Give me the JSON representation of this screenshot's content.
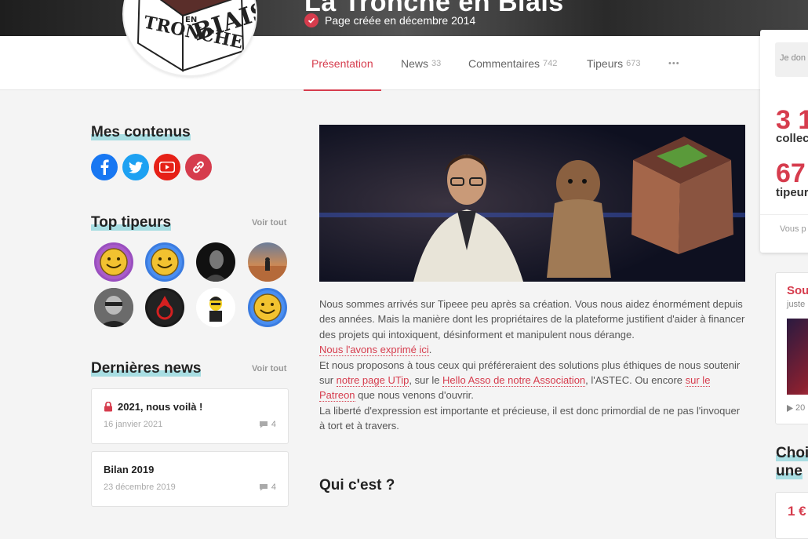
{
  "header": {
    "title": "La Tronche en Biais",
    "created_text": "Page créée en décembre 2014"
  },
  "logo": {
    "text_top": "TRONCHE",
    "text_side": "BIAIS",
    "text_bottom": "EN"
  },
  "nav": {
    "tabs": [
      {
        "label": "Présentation",
        "count": ""
      },
      {
        "label": "News",
        "count": "33"
      },
      {
        "label": "Commentaires",
        "count": "742"
      },
      {
        "label": "Tipeurs",
        "count": "673"
      }
    ],
    "more": "•••"
  },
  "sidebar": {
    "contents_title": "Mes contenus",
    "socials": [
      "facebook-icon",
      "twitter-icon",
      "youtube-icon",
      "link-icon"
    ],
    "top_title": "Top tipeurs",
    "top_more": "Voir tout",
    "news_title": "Dernières news",
    "news_more": "Voir tout",
    "news": [
      {
        "title": "2021, nous voilà !",
        "date": "16 janvier 2021",
        "comments": "4",
        "locked": true
      },
      {
        "title": "Bilan 2019",
        "date": "23 décembre 2019",
        "comments": "4",
        "locked": false
      }
    ]
  },
  "main": {
    "p1": "Nous sommes arrivés sur Tipeee peu après sa création. Vous nous aidez énormément depuis des années. Mais la manière dont les propriétaires de la plateforme justifient d'aider à financer des projets qui intoxiquent, désinforment et manipulent nous dérange.",
    "link1": "Nous l'avons exprimé ici",
    "link1_after": ".",
    "p2_start": "Et nous proposons à tous ceux qui préféreraient des solutions plus éthiques de nous soutenir sur ",
    "link2": "notre page UTip",
    "p2_mid1": ", sur le ",
    "link3": "Hello Asso de notre Association",
    "p2_mid2": ", l'ASTEC. Ou encore ",
    "link4": "sur le Patreon",
    "p2_end": " que nous venons d'ouvrir.",
    "p3": "La liberté d'expression est importante et précieuse, il est donc primordial de ne pas l'invoquer à tort et à travers.",
    "subhead": "Qui c'est ?"
  },
  "right": {
    "input_placeholder": "Je don",
    "stat1_num": "3 1",
    "stat1_label": "collec",
    "stat2_num": "67",
    "stat2_label": "tipeur",
    "footer": "Vous p",
    "video_title": "Sou",
    "video_sub": "juste",
    "video_meta": "20",
    "choose_line1": "Choi",
    "choose_line2": "une",
    "price": "1 €"
  },
  "colors": {
    "accent": "#d63c4d",
    "highlight": "#a8dde2"
  }
}
